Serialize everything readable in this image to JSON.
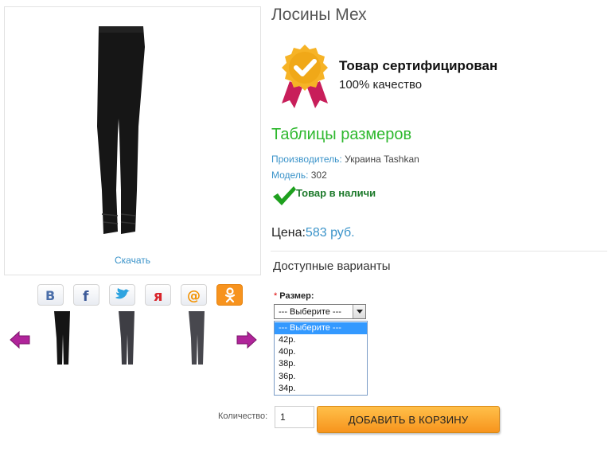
{
  "product": {
    "title": "Лосины Мех",
    "download_label": "Скачать"
  },
  "certificate": {
    "title": "Товар сертифицирован",
    "subtitle": "100% качество"
  },
  "size_tables_link": "Таблицы размеров",
  "meta": {
    "manufacturer_key": "Производитель:",
    "manufacturer_value": "Украина Tashkan",
    "model_key": "Модель:",
    "model_value": "302"
  },
  "stock": "Товар в наличи",
  "price": {
    "label": "Цена:",
    "value": "583 руб."
  },
  "variants_heading": "Доступные варианты",
  "size": {
    "required_mark": "*",
    "label": "Размер:",
    "selected": "--- Выберите ---",
    "options": [
      "--- Выберите ---",
      "42р.",
      "40р.",
      "38р.",
      "36р.",
      "34р."
    ]
  },
  "quantity": {
    "label": "Количество:",
    "value": "1"
  },
  "add_to_cart": "ДОБАВИТЬ В КОРЗИНУ",
  "social_icons": [
    "vk-icon",
    "facebook-icon",
    "twitter-icon",
    "yaru-icon",
    "mailru-icon",
    "odnoklassniki-icon"
  ],
  "colors": {
    "link_blue": "#3a93c9",
    "green": "#2eb82e",
    "button_orange": "#f7941d",
    "select_highlight": "#3399ff",
    "arrow_purple": "#a0208f"
  }
}
